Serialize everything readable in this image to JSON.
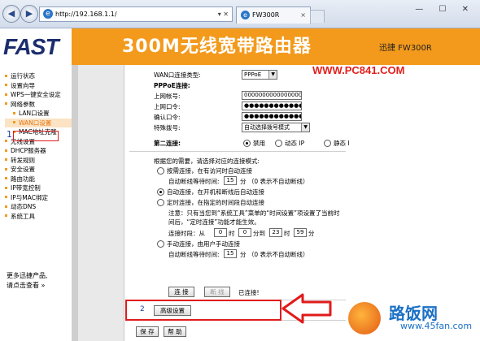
{
  "browser": {
    "url": "http://192.168.1.1/",
    "url_tools": "▾ ✕",
    "tab_title": "FW300R",
    "tab_close": "×",
    "window_buttons": "— ☐ ✕",
    "back_glyph": "◀",
    "forward_glyph": "▶",
    "ie_glyph": "e"
  },
  "header": {
    "logo": "FAST",
    "title": "300M无线宽带路由器",
    "model": "迅捷 FW300R",
    "watermark": "WWW.PC841.COM"
  },
  "sidebar": {
    "items": [
      {
        "label": "运行状态"
      },
      {
        "label": "设置向导"
      },
      {
        "label": "WPS一键安全设定"
      },
      {
        "label": "网络参数"
      },
      {
        "label": "LAN口设置"
      },
      {
        "label": "WAN口设置"
      },
      {
        "label": "MAC地址克隆"
      },
      {
        "label": "无线设置"
      },
      {
        "label": "DHCP服务器"
      },
      {
        "label": "转发规则"
      },
      {
        "label": "安全设置"
      },
      {
        "label": "路由功能"
      },
      {
        "label": "IP带宽控制"
      },
      {
        "label": "IP与MAC绑定"
      },
      {
        "label": "动态DNS"
      },
      {
        "label": "系统工具"
      }
    ],
    "more_line1": "更多迅捷产品,",
    "more_line2": "请点击查看 »",
    "step1": "1"
  },
  "form": {
    "wan_type_label": "WAN口连接类型:",
    "wan_type_value": "PPPoE",
    "pppoe_header": "PPPoE连接:",
    "account_label": "上网帐号:",
    "account_value": "0000000000000000",
    "password_label": "上网口令:",
    "password_value": "●●●●●●●●●●●●●",
    "confirm_label": "确认口令:",
    "confirm_value": "●●●●●●●●●●●●●",
    "dial_label": "特殊拨号:",
    "dial_value": "自动选择拨号模式",
    "second_label": "第二连接:",
    "second_options": [
      "禁用",
      "动态 IP",
      "静态 IP"
    ],
    "mode_intro": "根据您的需要，请选择对应的连接模式:",
    "mode1": "按需连接，在有访问时自动连接",
    "idle_label": "自动断线等待时间:",
    "idle_value": "15",
    "idle_unit": "分 （0 表示不自动断线）",
    "mode2": "自动连接，在开机和断线后自动连接",
    "mode3": "定时连接，在指定的时间段自动连接",
    "note": "注意：只有当您到“系统工具”菜单的“时间设置”项设置了当前时间后，“定时连接”功能才能生效。",
    "period_label": "连接时段：从",
    "period_h1": "0",
    "period_t1": "时",
    "period_m1": "0",
    "period_to": "分到",
    "period_h2": "23",
    "period_t2": "时",
    "period_m2": "59",
    "period_t3": "分",
    "mode4": "手动连接，由用户手动连接",
    "idle2_value": "15",
    "connect_btn": "连 接",
    "disconnect_btn": "断 线",
    "connected_text": "已连接!",
    "advanced_btn": "高级设置",
    "save_btn": "保 存",
    "help_btn": "帮 助",
    "step2": "2"
  },
  "watermark": {
    "text1": "路饭网",
    "text2": "www.45fan.com"
  }
}
